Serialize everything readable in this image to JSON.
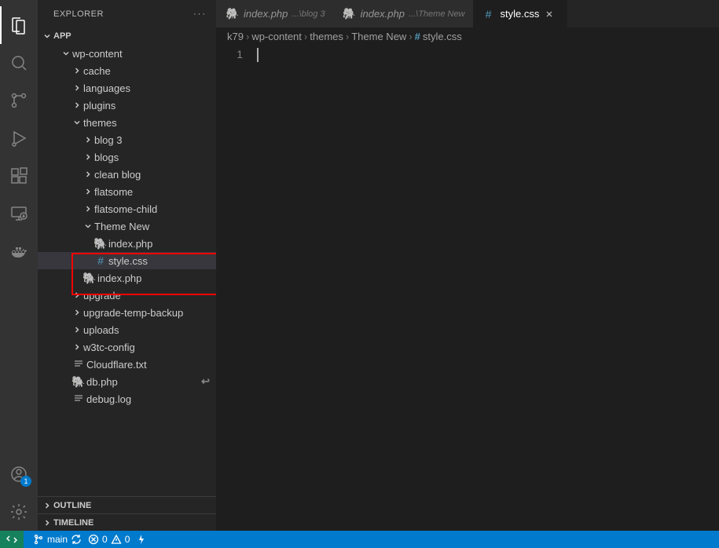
{
  "sidebar": {
    "title": "EXPLORER",
    "root": "APP",
    "outline": "OUTLINE",
    "timeline": "TIMELINE"
  },
  "tree": {
    "wpcontent": "wp-content",
    "cache": "cache",
    "languages": "languages",
    "plugins": "plugins",
    "themes": "themes",
    "blog3": "blog 3",
    "blogs": "blogs",
    "cleanblog": "clean blog",
    "flatsome": "flatsome",
    "flatsomechild": "flatsome-child",
    "themenew": "Theme New",
    "indexphp1": "index.php",
    "stylecss": "style.css",
    "indexphp2": "index.php",
    "upgrade": "upgrade",
    "upgradetemp": "upgrade-temp-backup",
    "uploads": "uploads",
    "w3tc": "w3tc-config",
    "cloudflare": "Cloudflare.txt",
    "dbphp": "db.php",
    "debuglog": "debug.log"
  },
  "tabs": [
    {
      "icon": "php",
      "label": "index.php",
      "path": "...\\blog 3",
      "active": false
    },
    {
      "icon": "php",
      "label": "index.php",
      "path": "...\\Theme New",
      "active": false
    },
    {
      "icon": "css",
      "label": "style.css",
      "path": "",
      "active": true
    }
  ],
  "breadcrumbs": [
    "k79",
    "wp-content",
    "themes",
    "Theme New",
    "style.css"
  ],
  "editor": {
    "line1": "1"
  },
  "statusbar": {
    "branch": "main",
    "errors": "0",
    "warnings": "0"
  },
  "accountBadge": "1"
}
